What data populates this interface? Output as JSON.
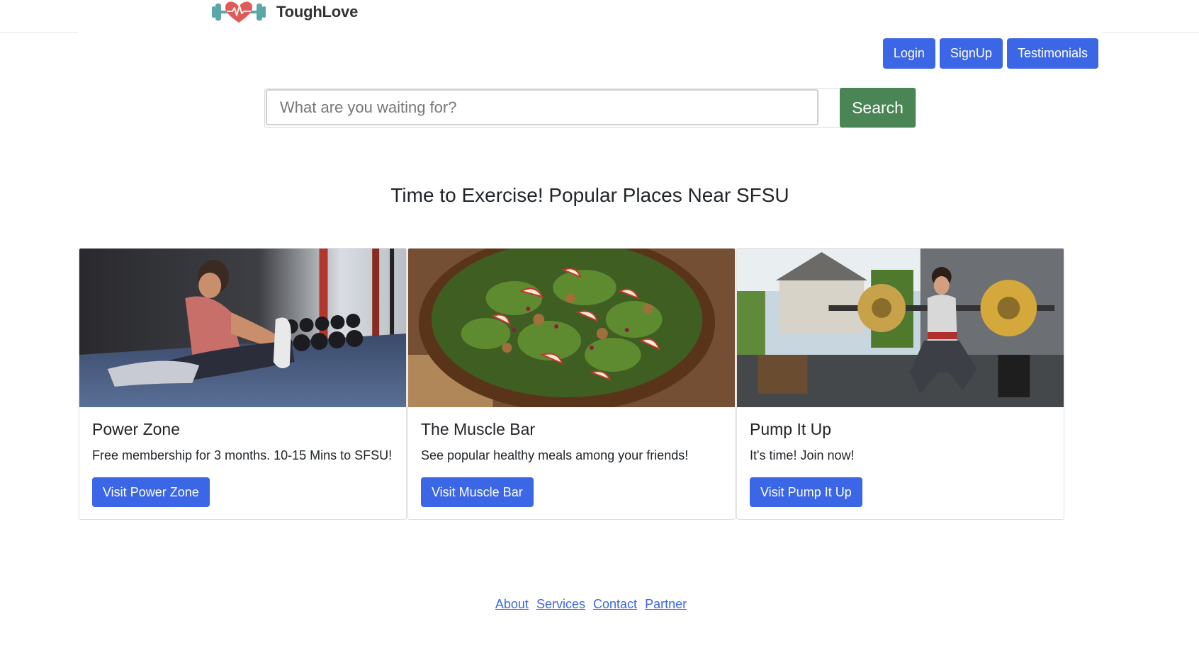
{
  "brand": {
    "name": "ToughLove",
    "logo_icon": "dumbbell-heart-icon"
  },
  "nav": {
    "login": "Login",
    "signup": "SignUp",
    "testimonials": "Testimonials"
  },
  "search": {
    "placeholder": "What are you waiting for?",
    "value": "",
    "button_label": "Search"
  },
  "headline": "Time to Exercise! Popular Places Near SFSU",
  "cards": [
    {
      "title": "Power Zone",
      "text": "Free membership for 3 months. 10-15 Mins to SFSU!",
      "button": "Visit Power Zone",
      "image": "woman-stretching-gym-photo"
    },
    {
      "title": "The Muscle Bar",
      "text": "See popular healthy meals among your friends!",
      "button": "Visit Muscle Bar",
      "image": "spinach-apple-salad-photo"
    },
    {
      "title": "Pump It Up",
      "text": "It's time! Join now!",
      "button": "Visit Pump It Up",
      "image": "woman-barbell-squat-garage-photo"
    }
  ],
  "footer": {
    "links": [
      "About",
      "Services",
      "Contact",
      "Partner"
    ]
  },
  "colors": {
    "primary": "#3b66e5",
    "search": "#4a8555",
    "logo_heart": "#e05a5a",
    "logo_dumbbell": "#5ba6a8"
  }
}
